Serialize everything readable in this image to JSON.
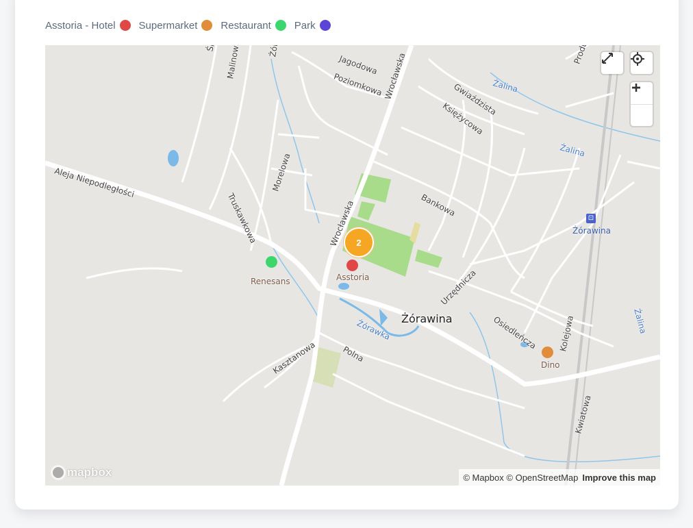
{
  "legend": {
    "items": [
      {
        "label": "Asstoria - Hotel",
        "color": "#e04848"
      },
      {
        "label": "Supermarket",
        "color": "#e08c3a"
      },
      {
        "label": "Restaurant",
        "color": "#3dd66c"
      },
      {
        "label": "Park",
        "color": "#5a45d8"
      }
    ]
  },
  "map": {
    "town_label": "Żórawina",
    "cluster_count": "2",
    "markers": [
      {
        "label": "Asstoria",
        "color": "#e04848"
      },
      {
        "label": "Renesans",
        "color": "#3dd66c"
      },
      {
        "label": "Dino",
        "color": "#e08c3a"
      }
    ],
    "station_label": "Żórawina",
    "streets": {
      "aleja": "Aleja Niepodległości",
      "truskawkowa": "Truskawkowa",
      "morelowa": "Morelowa",
      "malinowa": "Malinowa",
      "sliwk": "Śliwk",
      "jagodowa": "Jagodowa",
      "poziomkowa": "Poziomkowa",
      "wroclawska_top": "Wrocławska",
      "wroclawska_mid": "Wrocławska",
      "gwiazdzista": "Gwiaździsta",
      "ksiezycowa": "Księżycowa",
      "bankowa": "Bankowa",
      "urzednicza": "Urzędnicza",
      "osiedlencza": "Osiedleńcza",
      "kolejowa": "Kolejowa",
      "kwiatowa": "Kwiatowa",
      "kasztanowa": "Kasztanowa",
      "polna": "Polna",
      "produ": "Produ",
      "zor": "Żór"
    },
    "waters": {
      "zalina_1": "Żalina",
      "zalina_2": "Żalina",
      "zalina_3": "Żalina",
      "zorawka": "Żórawka"
    }
  },
  "controls": {
    "fullscreen_icon": "fullscreen-icon",
    "geolocate_icon": "geolocate-icon",
    "zoom_in_icon": "plus-icon",
    "zoom_out_icon": "minus-icon"
  },
  "attribution": {
    "mapbox": "© Mapbox",
    "osm": "© OpenStreetMap",
    "improve": "Improve this map"
  },
  "logo_text": "mapbox"
}
